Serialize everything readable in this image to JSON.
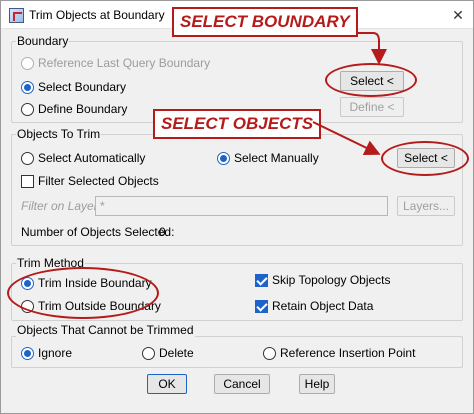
{
  "window": {
    "title": "Trim Objects at Boundary",
    "close_glyph": "✕"
  },
  "annotations": {
    "select_boundary": "SELECT BOUNDARY",
    "select_objects": "SELECT OBJECTS",
    "color": "#b51b1b"
  },
  "boundary": {
    "label": "Boundary",
    "reference_last": "Reference Last Query Boundary",
    "select_boundary": "Select Boundary",
    "define_boundary": "Define Boundary",
    "select_button": "Select <",
    "define_button": "Define <"
  },
  "objects_to_trim": {
    "label": "Objects To Trim",
    "select_automatically": "Select Automatically",
    "select_manually": "Select Manually",
    "filter_selected": "Filter Selected Objects",
    "filter_on_layers_label": "Filter on Layers:",
    "filter_on_layers_value": "*",
    "layers_button": "Layers...",
    "count_label": "Number of Objects Selected:",
    "count_value": "0",
    "select_button": "Select <"
  },
  "trim_method": {
    "label": "Trim Method",
    "inside": "Trim Inside Boundary",
    "outside": "Trim Outside Boundary",
    "skip_topology": "Skip Topology Objects",
    "retain_data": "Retain Object Data"
  },
  "cannot_trim": {
    "label": "Objects That Cannot be Trimmed",
    "ignore": "Ignore",
    "delete": "Delete",
    "reference_point": "Reference Insertion Point"
  },
  "footer": {
    "ok": "OK",
    "cancel": "Cancel",
    "help": "Help"
  },
  "accent_color": "#1e64c8"
}
